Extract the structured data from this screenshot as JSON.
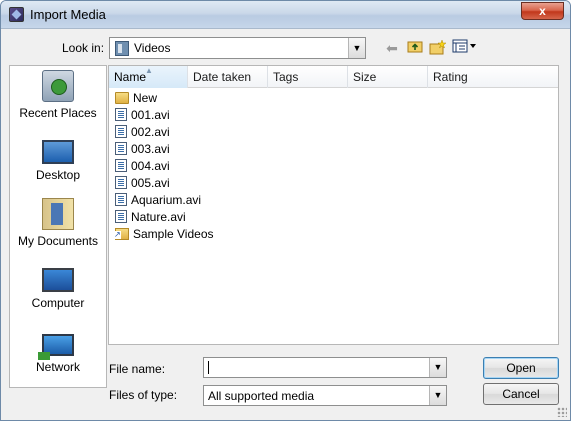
{
  "window": {
    "title": "Import Media",
    "close_glyph": "x"
  },
  "lookin": {
    "label": "Look in:",
    "value": "Videos"
  },
  "toolbar_icons": [
    "back-icon",
    "up-folder-icon",
    "new-folder-icon",
    "view-menu-icon"
  ],
  "places": [
    {
      "id": "recent",
      "label": "Recent Places",
      "icon": "recent-places-icon"
    },
    {
      "id": "desktop",
      "label": "Desktop",
      "icon": "desktop-icon"
    },
    {
      "id": "documents",
      "label": "My Documents",
      "icon": "my-documents-icon"
    },
    {
      "id": "computer",
      "label": "Computer",
      "icon": "computer-icon"
    },
    {
      "id": "network",
      "label": "Network",
      "icon": "network-icon"
    }
  ],
  "columns": [
    "Name",
    "Date taken",
    "Tags",
    "Size",
    "Rating"
  ],
  "files": [
    {
      "name": "New",
      "type": "folder"
    },
    {
      "name": "001.avi",
      "type": "video"
    },
    {
      "name": "002.avi",
      "type": "video"
    },
    {
      "name": "003.avi",
      "type": "video"
    },
    {
      "name": "004.avi",
      "type": "video"
    },
    {
      "name": "005.avi",
      "type": "video"
    },
    {
      "name": "Aquarium.avi",
      "type": "video"
    },
    {
      "name": "Nature.avi",
      "type": "video"
    },
    {
      "name": "Sample Videos",
      "type": "shortcut"
    }
  ],
  "filename": {
    "label": "File name:",
    "value": ""
  },
  "filetype": {
    "label": "Files of type:",
    "value": "All supported media"
  },
  "buttons": {
    "open": "Open",
    "cancel": "Cancel"
  }
}
